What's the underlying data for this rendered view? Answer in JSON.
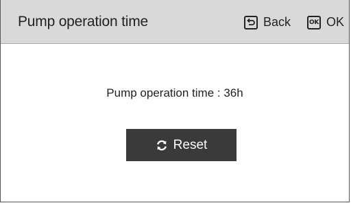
{
  "header": {
    "title": "Pump operation time",
    "back_label": "Back",
    "ok_icon_text": "OK",
    "ok_label": "OK"
  },
  "main": {
    "info_text": "Pump operation time : 36h",
    "reset_label": "Reset"
  },
  "icons": {
    "back": "back-arrow-icon",
    "ok": "ok-icon",
    "reset": "refresh-icon"
  },
  "colors": {
    "header_bg": "#d9d9d9",
    "button_bg": "#3a3a3a",
    "text": "#222222"
  }
}
